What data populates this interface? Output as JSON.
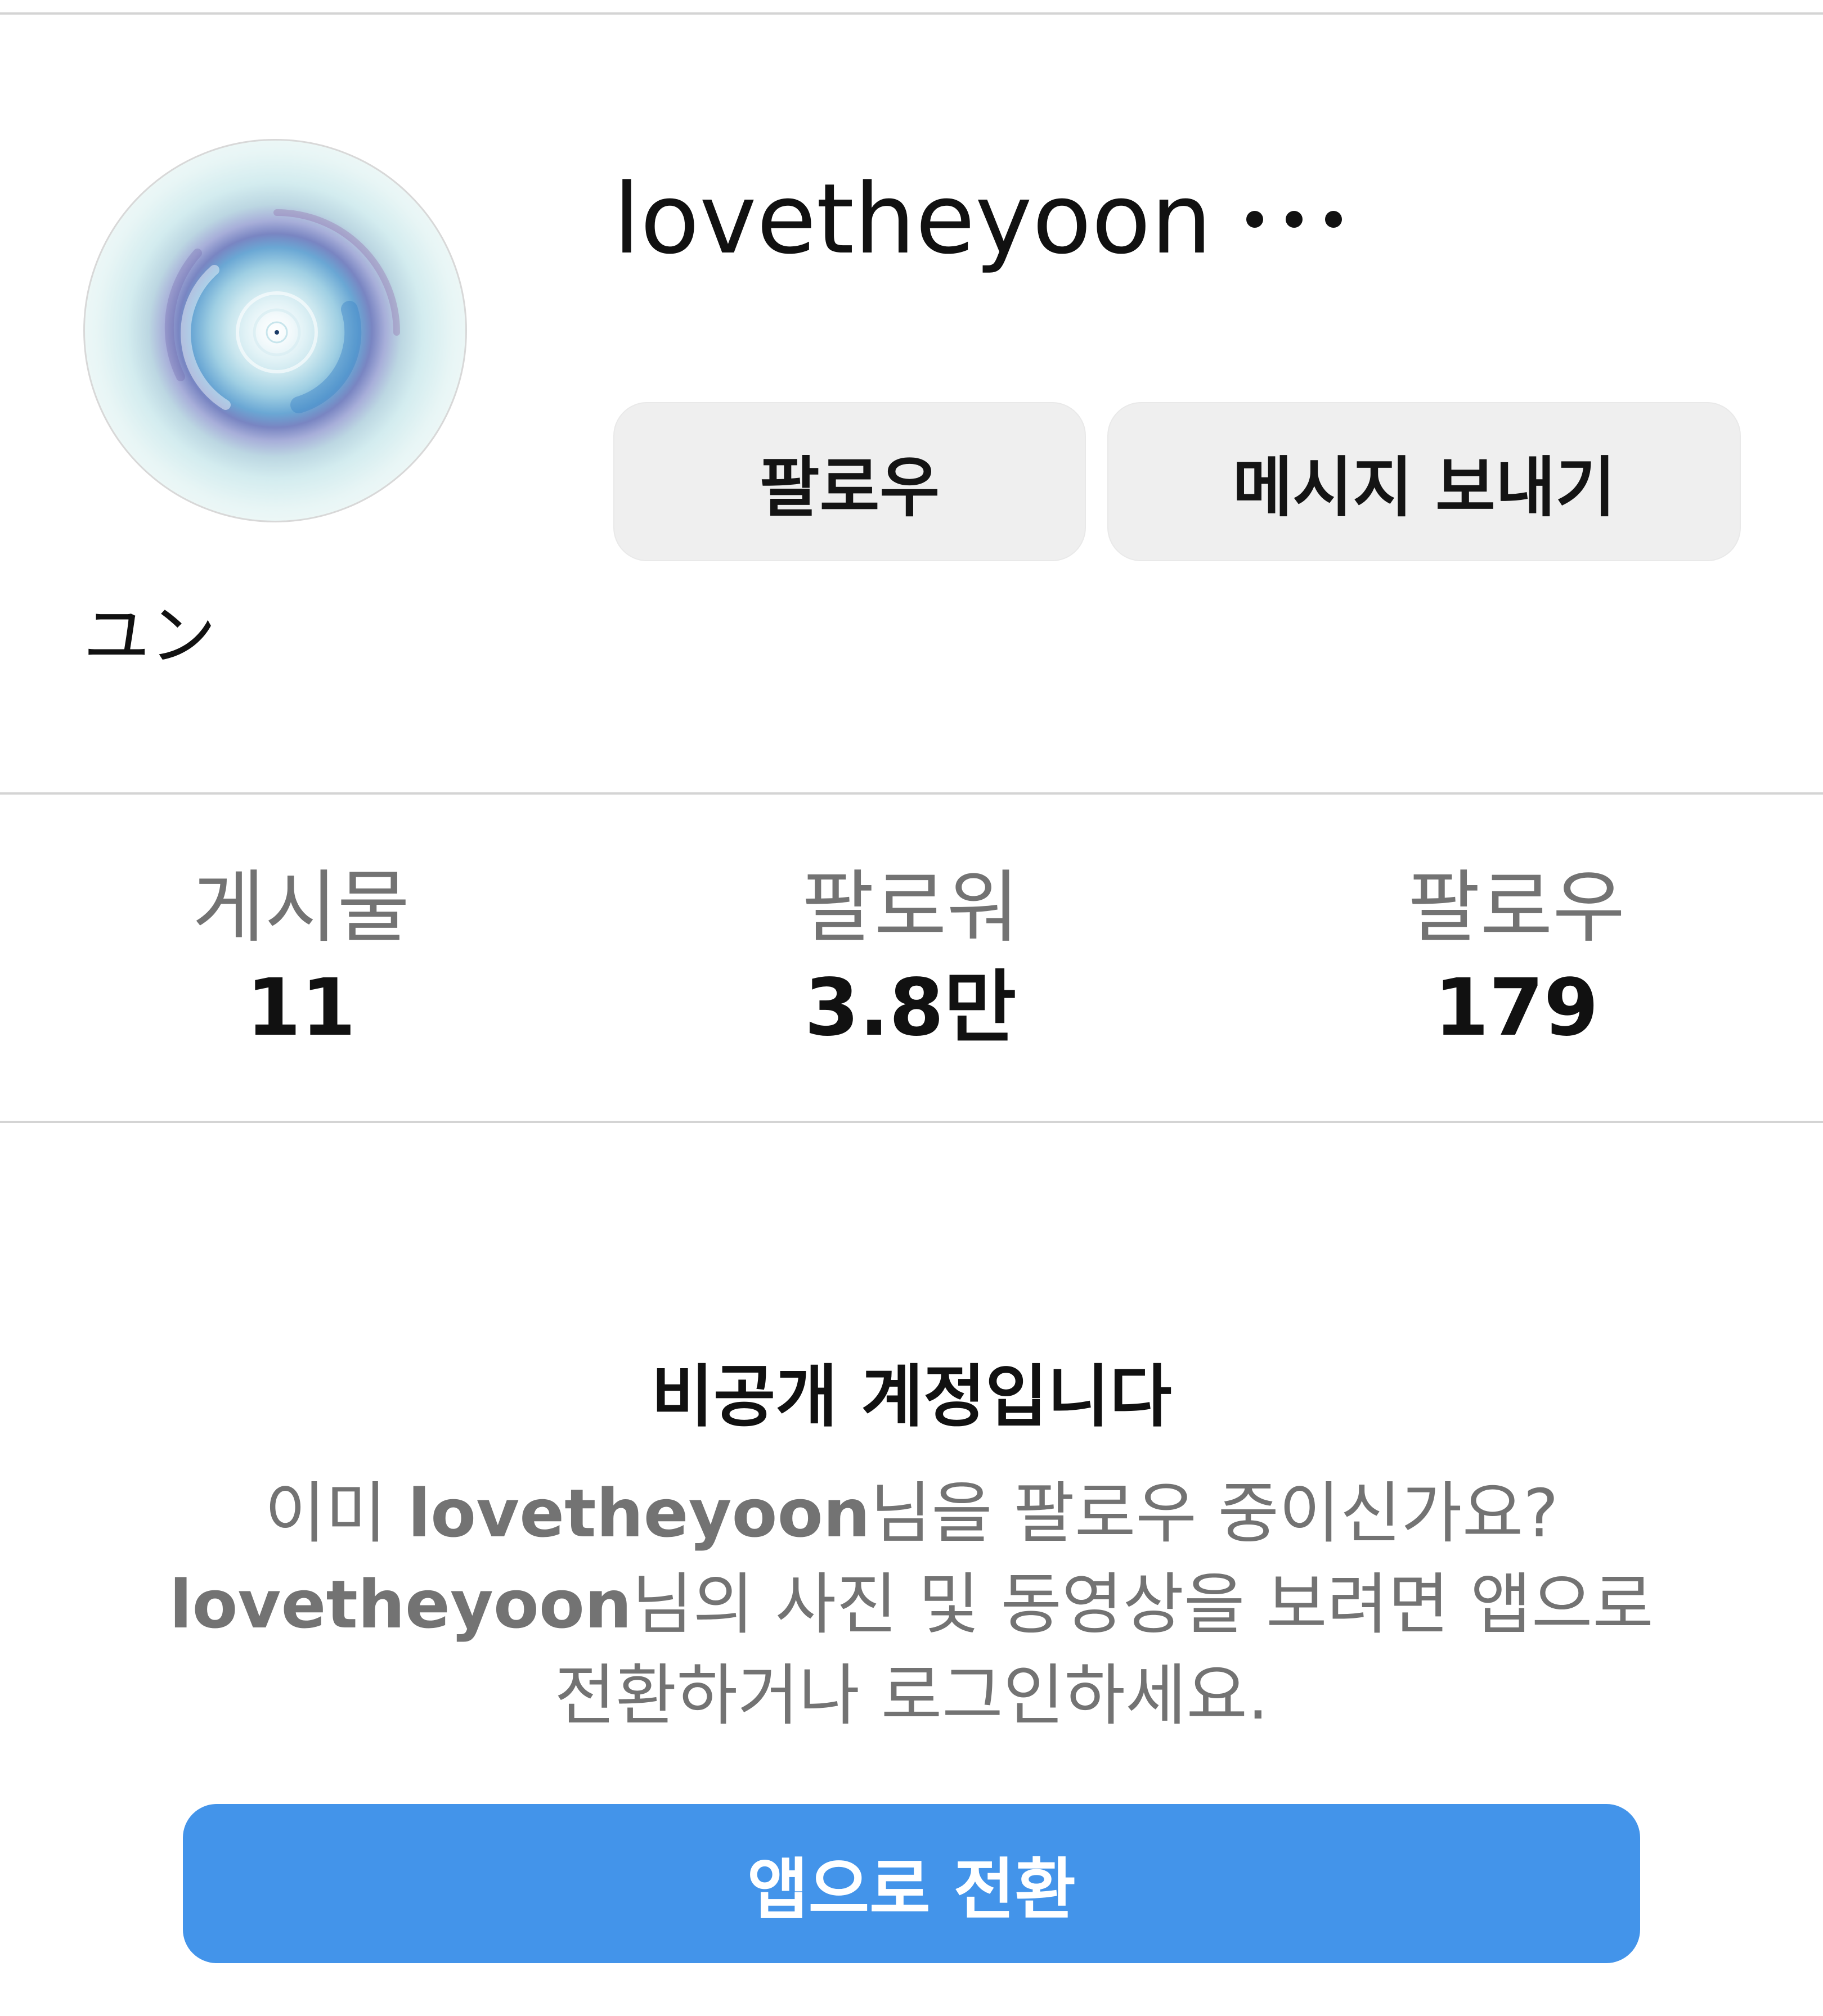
{
  "profile": {
    "username": "lovetheyoon",
    "display_name": "ユン",
    "more_icon": "more-horizontal-icon",
    "avatar": "swirl-image"
  },
  "actions": {
    "follow_label": "팔로우",
    "message_label": "메시지 보내기"
  },
  "stats": {
    "posts_label": "게시물",
    "posts_value": "11",
    "followers_label": "팔로워",
    "followers_value": "3.8만",
    "following_label": "팔로우",
    "following_value": "179"
  },
  "private_notice": {
    "title": "비공개 계정입니다",
    "line1_prefix": "이미 ",
    "line1_username": "lovetheyoon",
    "line1_suffix": "님을 팔로우 중이신가요?",
    "line2_username": "lovetheyoon",
    "line2_suffix": "님의 사진 및 동영상을 보려면 앱으로",
    "line3": "전환하거나 로그인하세요."
  },
  "switch_app_label": "앱으로 전환",
  "colors": {
    "primary_button": "#4394ea",
    "secondary_button": "#efefef",
    "muted_text": "#737373",
    "divider": "#d4d4d4"
  }
}
